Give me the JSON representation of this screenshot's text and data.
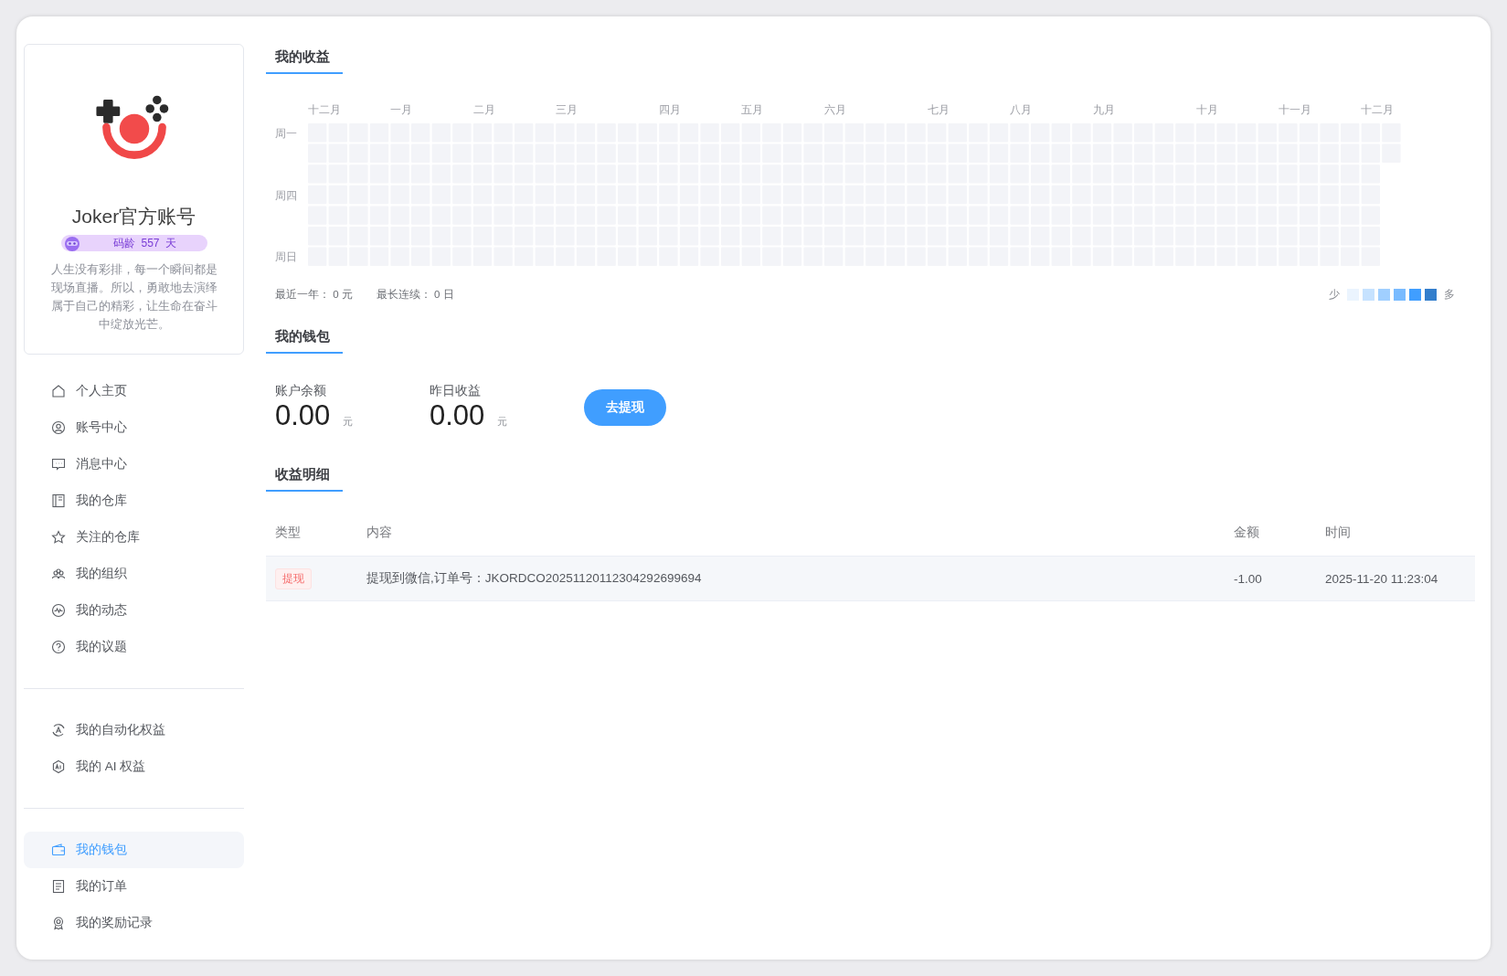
{
  "profile": {
    "name": "Joker官方账号",
    "badge": {
      "label": "码龄",
      "value": "557",
      "unit": "天"
    },
    "bio": "人生没有彩排，每一个瞬间都是现场直播。所以，勇敢地去演绎属于自己的精彩，让生命在奋斗中绽放光芒。"
  },
  "sidebar": {
    "groups": [
      {
        "items": [
          {
            "kind": "home",
            "label": "个人主页",
            "selected": false
          },
          {
            "kind": "account",
            "label": "账号中心",
            "selected": false
          },
          {
            "kind": "message",
            "label": "消息中心",
            "selected": false
          },
          {
            "kind": "repo",
            "label": "我的仓库",
            "selected": false
          },
          {
            "kind": "star",
            "label": "关注的仓库",
            "selected": false
          },
          {
            "kind": "team",
            "label": "我的组织",
            "selected": false
          },
          {
            "kind": "activity",
            "label": "我的动态",
            "selected": false
          },
          {
            "kind": "question",
            "label": "我的议题",
            "selected": false
          }
        ]
      },
      {
        "items": [
          {
            "kind": "auto",
            "label": "我的自动化权益",
            "selected": false
          },
          {
            "kind": "ai",
            "label": "我的 AI 权益",
            "selected": false
          }
        ]
      },
      {
        "items": [
          {
            "kind": "wallet",
            "label": "我的钱包",
            "selected": true
          },
          {
            "kind": "order",
            "label": "我的订单",
            "selected": false
          },
          {
            "kind": "award",
            "label": "我的奖励记录",
            "selected": false
          }
        ]
      }
    ]
  },
  "earnings": {
    "title": "我的收益",
    "months": [
      "十二月",
      "一月",
      "二月",
      "三月",
      "四月",
      "五月",
      "六月",
      "七月",
      "八月",
      "九月",
      "十月",
      "十一月",
      "十二月"
    ],
    "weekdays": [
      "周一",
      "周四",
      "周日"
    ],
    "summary": [
      "最近一年： 0 元",
      "最长连续： 0 日"
    ],
    "legend": {
      "less": "少",
      "more": "多",
      "swatches": [
        {
          "color": "#ebf4fe"
        },
        {
          "color": "#c6e2ff"
        },
        {
          "color": "#a0cfff"
        },
        {
          "color": "#79bbff"
        },
        {
          "color": "#409eff"
        },
        {
          "color": "#337ecc"
        }
      ]
    }
  },
  "wallet": {
    "title": "我的钱包",
    "stats": [
      {
        "label": "账户余额",
        "value": "0.00",
        "unit": "元"
      },
      {
        "label": "昨日收益",
        "value": "0.00",
        "unit": "元"
      }
    ],
    "withdraw_button": "去提现"
  },
  "details": {
    "title": "收益明细",
    "columns": [
      "类型",
      "内容",
      "金额",
      "时间"
    ],
    "rows": [
      {
        "type": "提现",
        "content": "提现到微信,订单号：JKORDCO20251120112304292699694",
        "amount": "-1.00",
        "time": "2025-11-20 11:23:04"
      }
    ]
  }
}
